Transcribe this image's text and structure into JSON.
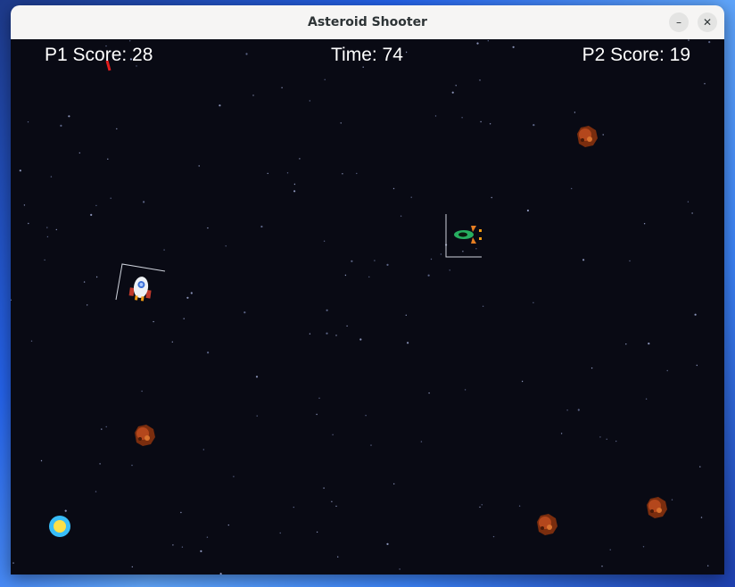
{
  "window": {
    "title": "Asteroid Shooter",
    "minimize_symbol": "–",
    "close_symbol": "✕"
  },
  "hud": {
    "p1_score_label": "P1 Score: 28",
    "time_label": "Time: 74",
    "p2_score_label": "P2 Score: 19"
  },
  "colors": {
    "space_background": "#090a14",
    "hud_text": "#ffffff",
    "laser": "#e11d1d",
    "asteroid": "#b4471c",
    "powerup_ring": "#38bdf8",
    "powerup_core": "#fde047"
  },
  "sprites": {
    "player1_ship": "white-red-rocket-icon",
    "player2_ship": "green-orange-fighter-icon",
    "asteroid": "asteroid-icon",
    "powerup": "powerup-orb-icon"
  }
}
